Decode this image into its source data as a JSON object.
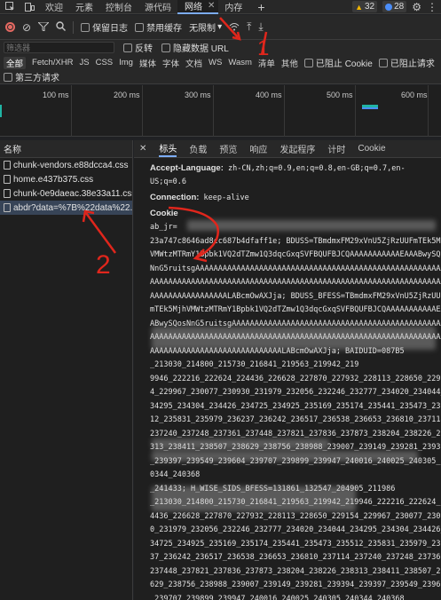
{
  "tabbar": {
    "tabs": [
      "欢迎",
      "元素",
      "控制台",
      "源代码",
      "网络",
      "内存"
    ],
    "active_close": "✕",
    "warnings": "32",
    "messages": "28"
  },
  "toolbar": {
    "preserve_log": "保留日志",
    "disable_cache": "禁用缓存",
    "throttle": "无限制"
  },
  "filter": {
    "placeholder": "筛选器",
    "invert": "反转",
    "hide_data_urls": "隐藏数据 URL"
  },
  "types": [
    "全部",
    "Fetch/XHR",
    "JS",
    "CSS",
    "Img",
    "媒体",
    "字体",
    "文档",
    "WS",
    "Wasm",
    "清单",
    "其他"
  ],
  "blocked_cookies": "已阻止 Cookie",
  "blocked_requests": "已阻止请求",
  "third_party": "第三方请求",
  "timeline": {
    "ticks": [
      "100 ms",
      "200 ms",
      "300 ms",
      "400 ms",
      "500 ms",
      "600 ms"
    ]
  },
  "reqlist": {
    "header": "名称",
    "items": [
      "chunk-vendors.e88dcca4.css",
      "home.e437b375.css",
      "chunk-0e9daeac.38e33a11.css",
      "abdr?data=%7B%22data%22..."
    ]
  },
  "detail": {
    "tabs": [
      "标头",
      "负载",
      "预览",
      "响应",
      "发起程序",
      "计时",
      "Cookie"
    ],
    "accept_language_label": "Accept-Language:",
    "accept_language_value": "zh-CN,zh;q=0.9,en;q=0.8,en-GB;q=0.7,en-US;q=0.6",
    "connection_label": "Connection:",
    "connection_value": "keep-alive",
    "cookie_label": "Cookie",
    "cookie_lines": [
      "ab_jr=",
      "23a747c8646ad8cc687b4dfaff1e; BDUSS=TBmdmxFM29xVnU5ZjRzUUFmTEk5Mjh",
      "VMWtzMTRmY1Bpbk1VQ2dTZmw1Q3dqcGxqSVFBQUFBJCQAAAAAAAAAAAEAAABwySQos",
      "NnG5ruitsgAAAAAAAAAAAAAAAAAAAAAAAAAAAAAAAAAAAAAAAAAAAAAAAAAAAAAAAA",
      "AAAAAAAAAAAAAAAAAAAAAAAAAAAAAAAAAAAAAAAAAAAAAAAAAAAAAAAAAAAAAAAAAA",
      "AAAAAAAAAAAAAAAAALABcmOwAXJja; BDUSS_BFESS=TBmdmxFM29xVnU5ZjRzUUF",
      "mTEk5MjhVMWtzMTRmY1Bpbk1VQ2dTZmw1Q3dqcGxqSVFBQUFBJCQAAAAAAAAAAAEAA",
      "ABwySQosNnG5ruitsgAAAAAAAAAAAAAAAAAAAAAAAAAAAAAAAAAAAAAAAAAAAAAAAA",
      "AAAAAAAAAAAAAAAAAAAAAAAAAAAAAAAAAAAAAAAAAAAAAAAAAAAAAAAAAAAAAAAAAA",
      "AAAAAAAAAAAAAAAAAAAAAAAAAAAAALABcmOwAXJja; BAIDUID=087B5",
      "",
      "",
      "_213030_214800_215730_216841_219563_219942_219",
      "9946_222216_222624_224436_226628_227870_227932_228113_228650_22915",
      "4_229967_230077_230930_231979_232056_232246_232777_234020_234044_2",
      "34295_234304_234426_234725_234925_235169_235174_235441_235473_2355",
      "12_235831_235979_236237_236242_236517_236538_236653_236810_237114_",
      "237240_237248_237361_237448_237821_237836_237873_238204_238226_238",
      "313_238411_238507_238629_238756_238988_239007_239149_239281_239394",
      "_239397_239549_239604_239707_239899_239947_240016_240025_240305_24",
      "0344_240368",
      "",
      "",
      "_241433; H_WISE_SIDS_BFESS=131861_132547_204905_211986",
      "_213030_214800_215730_216841_219563_219942_219946_222216_222624_22",
      "4436_226628_227870_227932_228113_228650_229154_229967_230077_23093",
      "0_231979_232056_232246_232777_234020_234044_234295_234304_234426_2",
      "34725_234925_235169_235174_235441_235473_235512_235831_235979_2362",
      "37_236242_236517_236538_236653_236810_237114_237240_237248_237361_",
      "237448_237821_237836_237873_238204_238226_238313_238411_238507_238",
      "629_238756_238988_239007_239149_239281_239394_239397_239549_239604",
      "_239707_239899_239947_240016_240025_240305_240344_240368"
    ]
  },
  "annotations": [
    "1",
    "2"
  ]
}
